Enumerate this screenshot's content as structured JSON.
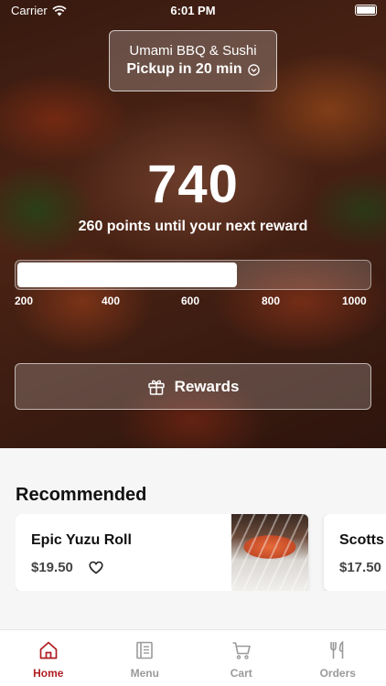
{
  "status_bar": {
    "carrier": "Carrier",
    "time": "6:01 PM"
  },
  "store": {
    "name": "Umami BBQ & Sushi",
    "pickup": "Pickup in 20 min"
  },
  "loyalty": {
    "points": "740",
    "until_text": "260 points until your next reward",
    "progress_fraction": 0.625,
    "ticks": [
      "200",
      "400",
      "600",
      "800",
      "1000"
    ],
    "rewards_label": "Rewards"
  },
  "recommended": {
    "title": "Recommended",
    "items": [
      {
        "name": "Epic Yuzu Roll",
        "price": "$19.50"
      },
      {
        "name": "Scotts",
        "price": "$17.50"
      }
    ]
  },
  "tabs": [
    {
      "label": "Home",
      "icon": "home-icon",
      "active": true
    },
    {
      "label": "Menu",
      "icon": "menu-icon",
      "active": false
    },
    {
      "label": "Cart",
      "icon": "cart-icon",
      "active": false
    },
    {
      "label": "Orders",
      "icon": "orders-icon",
      "active": false
    }
  ],
  "colors": {
    "accent": "#b01e23",
    "inactive_tab": "#9a9a9a"
  }
}
